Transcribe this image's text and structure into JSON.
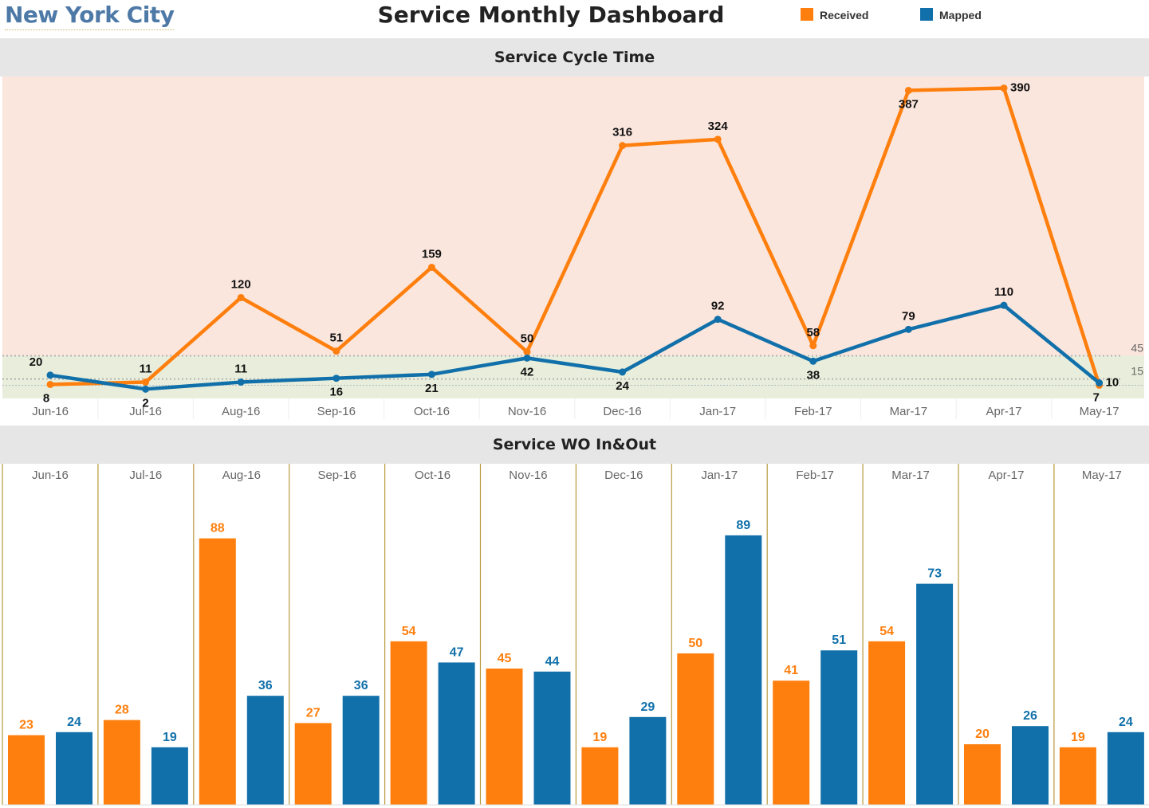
{
  "header": {
    "city": "New York City",
    "title": "Service Monthly Dashboard",
    "legend": [
      {
        "label": "Received",
        "color": "#ff7f0e"
      },
      {
        "label": "Mapped",
        "color": "#1170aa"
      }
    ]
  },
  "colors": {
    "received": "#ff7f0e",
    "mapped": "#1170aa",
    "band_high": "#fbe6dd",
    "band_low": "#e8eedb",
    "divider": "#b89a3e"
  },
  "chart_data": [
    {
      "type": "line",
      "title": "Service Cycle Time",
      "categories": [
        "Jun-16",
        "Jul-16",
        "Aug-16",
        "Sep-16",
        "Oct-16",
        "Nov-16",
        "Dec-16",
        "Jan-17",
        "Feb-17",
        "Mar-17",
        "Apr-17",
        "May-17"
      ],
      "series": [
        {
          "name": "Received",
          "values": [
            8,
            11,
            120,
            51,
            159,
            50,
            316,
            324,
            58,
            387,
            390,
            7
          ]
        },
        {
          "name": "Mapped",
          "values": [
            20,
            2,
            11,
            16,
            21,
            42,
            24,
            92,
            38,
            79,
            110,
            10
          ]
        }
      ],
      "ylim": [
        -10,
        405
      ],
      "reference_lines": [
        45,
        15
      ],
      "reference_labels": [
        "45",
        "15"
      ],
      "bands": [
        {
          "from": 45,
          "to": 405,
          "color": "#fbe6dd"
        },
        {
          "from": -10,
          "to": 45,
          "color": "#e8eedb"
        }
      ],
      "grid": false,
      "legend": "top-right"
    },
    {
      "type": "bar",
      "title": "Service WO In&Out",
      "categories": [
        "Jun-16",
        "Jul-16",
        "Aug-16",
        "Sep-16",
        "Oct-16",
        "Nov-16",
        "Dec-16",
        "Jan-17",
        "Feb-17",
        "Mar-17",
        "Apr-17",
        "May-17"
      ],
      "series": [
        {
          "name": "Received",
          "values": [
            23,
            28,
            88,
            27,
            54,
            45,
            19,
            50,
            41,
            54,
            20,
            19
          ]
        },
        {
          "name": "Mapped",
          "values": [
            24,
            19,
            36,
            36,
            47,
            44,
            29,
            89,
            51,
            73,
            26,
            24
          ]
        }
      ],
      "ylim": [
        0,
        100
      ],
      "grid": false
    }
  ]
}
